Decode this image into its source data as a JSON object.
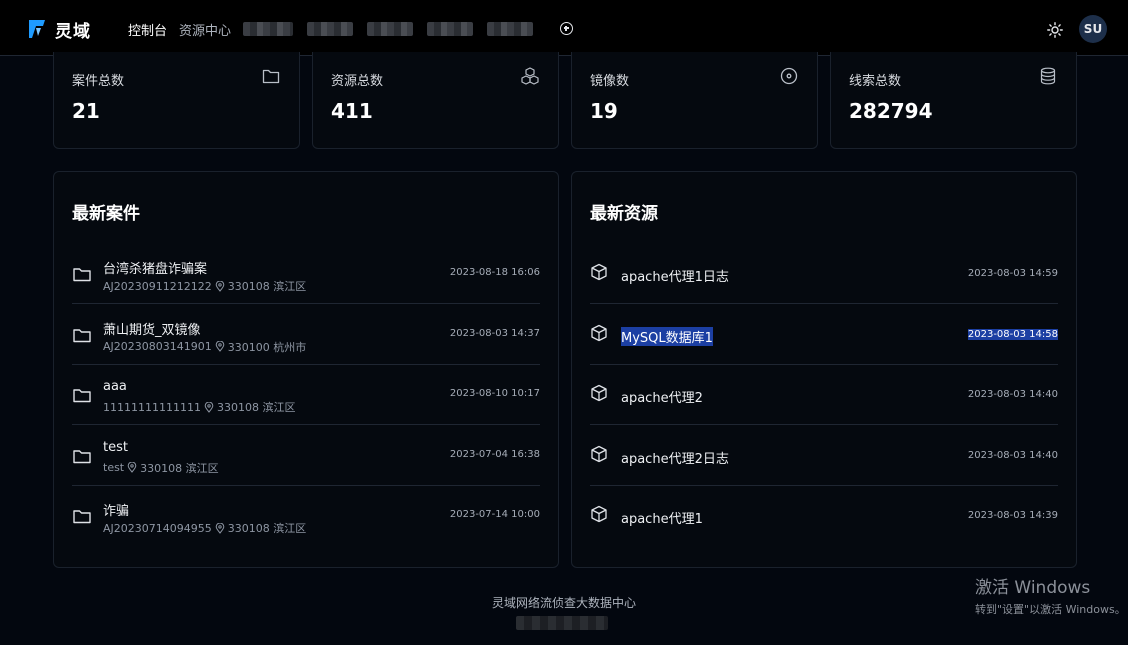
{
  "app": {
    "name": "灵域",
    "accent": "#1e9bff"
  },
  "nav": {
    "dashboard": "控制台",
    "resources": "资源中心"
  },
  "header": {
    "avatar_initials": "SU",
    "theme_icon": "sun-icon",
    "add_icon": "plus-circle-icon"
  },
  "stats": [
    {
      "label": "案件总数",
      "value": "21",
      "icon": "folder-icon"
    },
    {
      "label": "资源总数",
      "value": "411",
      "icon": "cubes-icon"
    },
    {
      "label": "镜像数",
      "value": "19",
      "icon": "disc-icon"
    },
    {
      "label": "线索总数",
      "value": "282794",
      "icon": "database-icon"
    }
  ],
  "cases": {
    "title": "最新案件",
    "items": [
      {
        "name": "台湾杀猪盘诈骗案",
        "id": "AJ20230911212122",
        "region": "330108 滨江区",
        "time": "2023-08-18 16:06"
      },
      {
        "name": "萧山期货_双镜像",
        "id": "AJ20230803141901",
        "region": "330100 杭州市",
        "time": "2023-08-03 14:37"
      },
      {
        "name": "aaa",
        "id": "11111111111111",
        "region": "330108 滨江区",
        "time": "2023-08-10 10:17"
      },
      {
        "name": "test",
        "id": "test",
        "region": "330108 滨江区",
        "time": "2023-07-04 16:38"
      },
      {
        "name": "诈骗",
        "id": "AJ20230714094955",
        "region": "330108 滨江区",
        "time": "2023-07-14 10:00"
      }
    ]
  },
  "resources": {
    "title": "最新资源",
    "items": [
      {
        "name": "apache代理1日志",
        "time": "2023-08-03 14:59",
        "selected": false
      },
      {
        "name": "MySQL数据库1",
        "time": "2023-08-03 14:58",
        "selected": true
      },
      {
        "name": "apache代理2",
        "time": "2023-08-03 14:40",
        "selected": false
      },
      {
        "name": "apache代理2日志",
        "time": "2023-08-03 14:40",
        "selected": false
      },
      {
        "name": "apache代理1",
        "time": "2023-08-03 14:39",
        "selected": false
      }
    ]
  },
  "footer": {
    "text": "灵域网络流侦查大数据中心"
  },
  "watermark": {
    "title": "激活 Windows",
    "subtitle": "转到\"设置\"以激活 Windows。"
  }
}
